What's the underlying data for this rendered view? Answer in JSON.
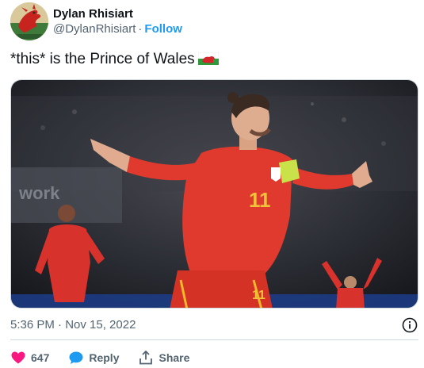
{
  "author": {
    "display_name": "Dylan Rhisiart",
    "handle": "@DylanRhisiart",
    "separator": "·",
    "follow_label": "Follow",
    "avatar_icon": "red-dragon-avatar"
  },
  "tweet": {
    "text": "*this* is the Prince of Wales",
    "emoji": "wales-flag-emoji",
    "timestamp": "5:36 PM · Nov 15, 2022"
  },
  "media": {
    "alt": "footballer-celebrating-photo",
    "jersey_number": "11",
    "jersey_number_2": "11"
  },
  "actions": {
    "like_count": "647",
    "reply_label": "Reply",
    "share_label": "Share"
  },
  "colors": {
    "link": "#1d9bf0",
    "text": "#0f1419",
    "secondary": "#536471",
    "like": "#f91880",
    "reply": "#1d9bf0",
    "divider": "#cfd9de"
  }
}
